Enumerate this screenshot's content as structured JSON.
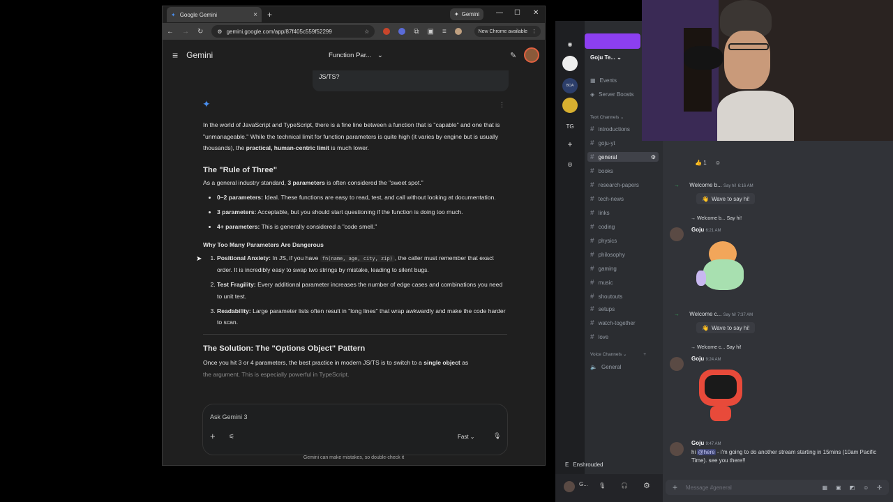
{
  "browser": {
    "tab_title": "Google Gemini",
    "gemini_button": "Gemini",
    "url": "gemini.google.com/app/87f405c559f52299",
    "new_chrome": "New Chrome available"
  },
  "gemini": {
    "brand": "Gemini",
    "conversation_title": "Function Par...",
    "user_message_tail": "JS/TS?",
    "intro_1": "In the world of JavaScript and TypeScript, there is a fine line between a function that is \"capable\" and one that is \"unmanageable.\" While the technical limit for function parameters is quite high (it varies by engine but is usually thousands), the ",
    "intro_bold": "practical, human-centric limit",
    "intro_2": " is much lower.",
    "h_rule": "The \"Rule of Three\"",
    "rule_p1": "As a general industry standard, ",
    "rule_bold": "3 parameters",
    "rule_p2": " is often considered the \"sweet spot.\"",
    "bullets": [
      {
        "bold": "0–2 parameters:",
        "text": " Ideal. These functions are easy to read, test, and call without looking at documentation."
      },
      {
        "bold": "3 parameters:",
        "text": " Acceptable, but you should start questioning if the function is doing too much."
      },
      {
        "bold": "4+ parameters:",
        "text": " This is generally considered a \"code smell.\""
      }
    ],
    "h_why": "Why Too Many Parameters Are Dangerous",
    "why": [
      {
        "bold": "Positional Anxiety:",
        "pre": " In JS, if you have ",
        "code": "fn(name, age, city, zip)",
        "post": ", the caller must remember that exact order. It is incredibly easy to swap two strings by mistake, leading to silent bugs."
      },
      {
        "bold": "Test Fragility:",
        "pre": " Every additional parameter increases the number of edge cases and combinations you need to unit test.",
        "code": "",
        "post": ""
      },
      {
        "bold": "Readability:",
        "pre": " Large parameter lists often result in \"long lines\" that wrap awkwardly and make the code harder to scan.",
        "code": "",
        "post": ""
      }
    ],
    "h_solution": "The Solution: The \"Options Object\" Pattern",
    "sol_1": "Once you hit 3 or 4 parameters, the best practice in modern JS/TS is to switch to a ",
    "sol_bold": "single object",
    "sol_2": " as",
    "sol_fade": "the argument. This is especially powerful in TypeScript.",
    "input_placeholder": "Ask Gemini 3",
    "mode": "Fast",
    "disclaimer": "Gemini can make mistakes, so double-check it"
  },
  "discord": {
    "guild": "Goju Te...",
    "server_tg": "TG",
    "top_items": [
      "Events",
      "Server Boosts"
    ],
    "text_category": "Text Channels",
    "channels": [
      "introductions",
      "goju-yt",
      "general",
      "books",
      "research-papers",
      "tech-news",
      "links",
      "coding",
      "physics",
      "philosophy",
      "gaming",
      "music",
      "shoutouts",
      "setups",
      "watch-together",
      "love"
    ],
    "voice_category": "Voice Channels",
    "voice_channels": [
      "General"
    ],
    "activity": "Enshrouded",
    "user_short": "G...",
    "reaction_count": "1",
    "messages": {
      "welcome1": "Welcome b...",
      "say_hi": "Say hi!",
      "ts1": "6:16 AM",
      "wave": "Wave to say hi!",
      "reply1": "Welcome b...",
      "goju": "Goju",
      "ts2": "6:21 AM",
      "welcome2": "Welcome c...",
      "ts3": "7:37 AM",
      "reply2": "Welcome c...",
      "ts4": "9:24 AM",
      "ts5": "9:47 AM",
      "final_pre": "hi ",
      "mention": "@here",
      "final_post": " - i'm going to do another stream starting in 15mins (10am Pacific Time). see you there!!"
    },
    "compose_placeholder": "Message #general"
  }
}
